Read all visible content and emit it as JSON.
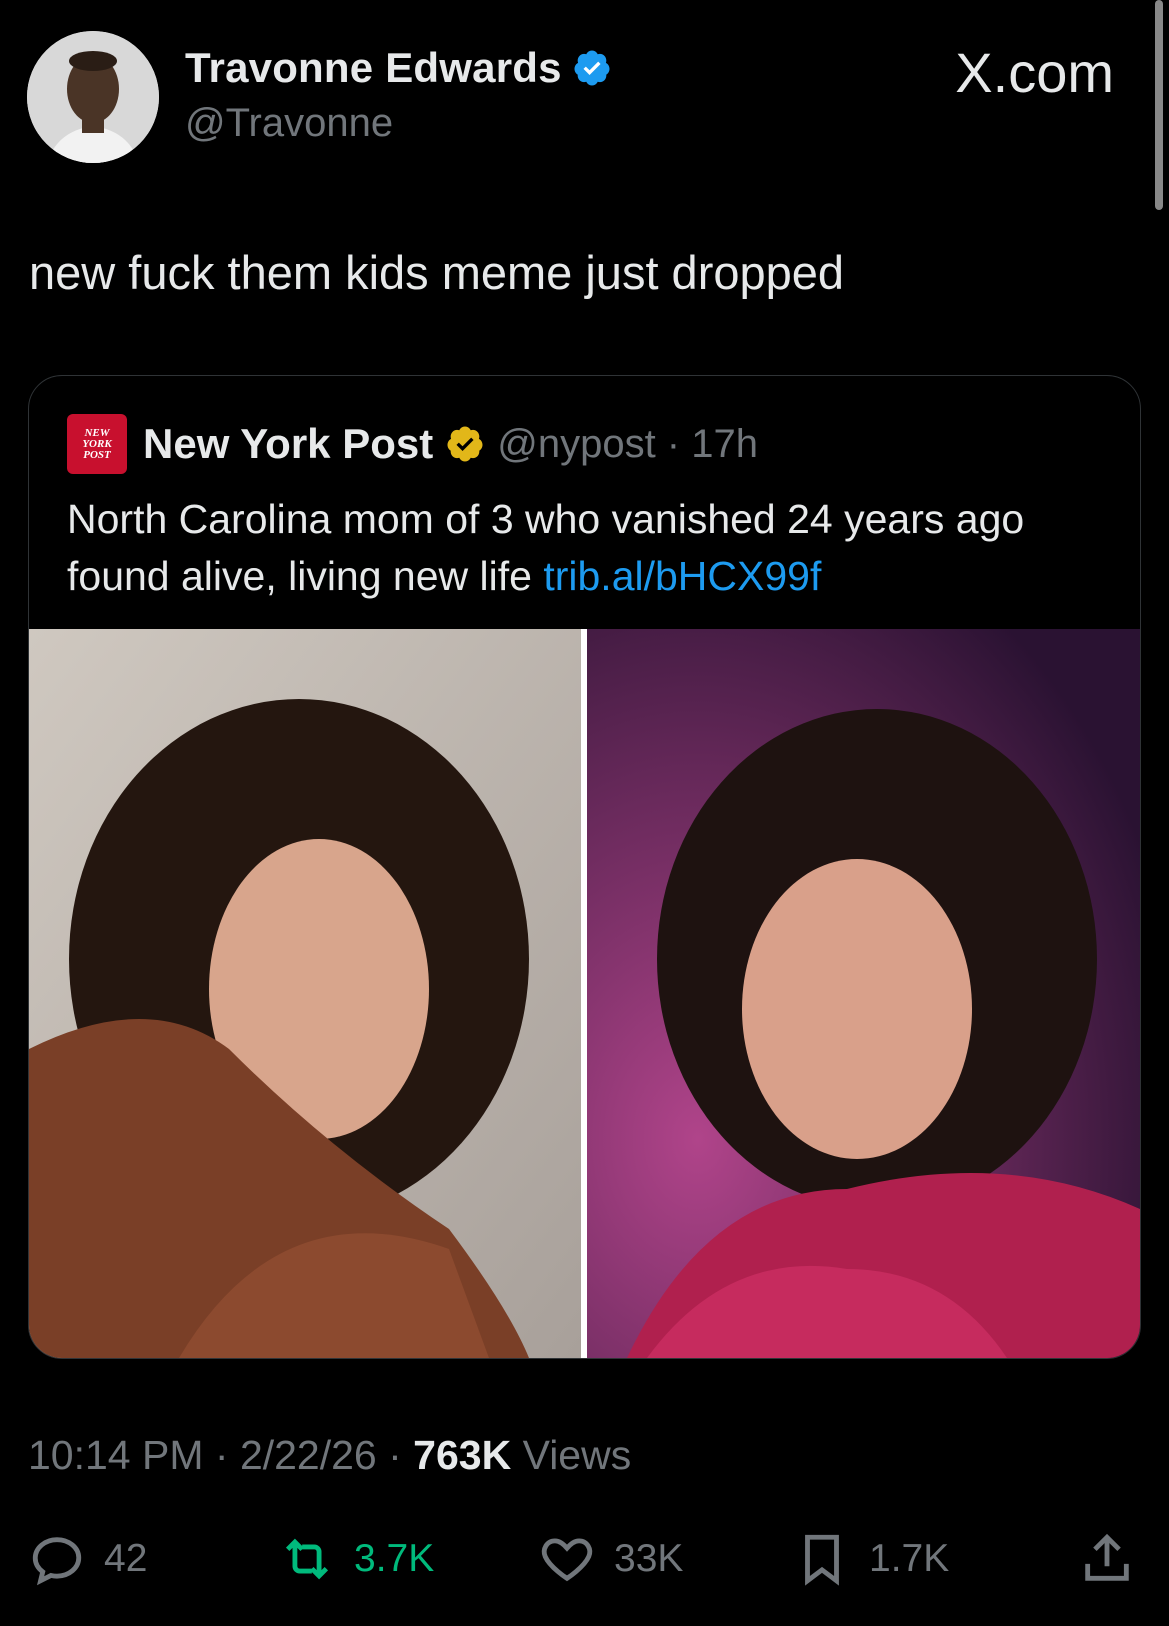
{
  "author": {
    "display_name": "Travonne Edwards",
    "handle": "@Travonne",
    "verified": true,
    "verified_color": "#1d9bf0"
  },
  "brand": "X.com",
  "tweet": {
    "text": "new fuck them kids meme just dropped"
  },
  "quoted": {
    "logo_text": [
      "NEW",
      "YORK",
      "POST"
    ],
    "name": "New York Post",
    "badge_color": "#e2b719",
    "handle_time": "@nypost · 17h",
    "text": "North Carolina mom of 3 who vanished 24 years ago found alive, living new life",
    "link": "trib.al/bHCX99f",
    "photos": [
      "woman-brown-fringe-jacket-photo",
      "woman-pink-sequin-jacket-photo"
    ]
  },
  "meta": {
    "time": "10:14 PM",
    "date": "2/22/26",
    "views": "763K",
    "views_label": "Views",
    "separator": " · "
  },
  "actions": {
    "replies": "42",
    "retweets": "3.7K",
    "likes": "33K",
    "bookmarks": "1.7K"
  },
  "colors": {
    "background": "#000000",
    "text": "#e7e9ea",
    "muted": "#71767b",
    "link": "#1d9bf0",
    "retweet": "#00ba7c"
  }
}
